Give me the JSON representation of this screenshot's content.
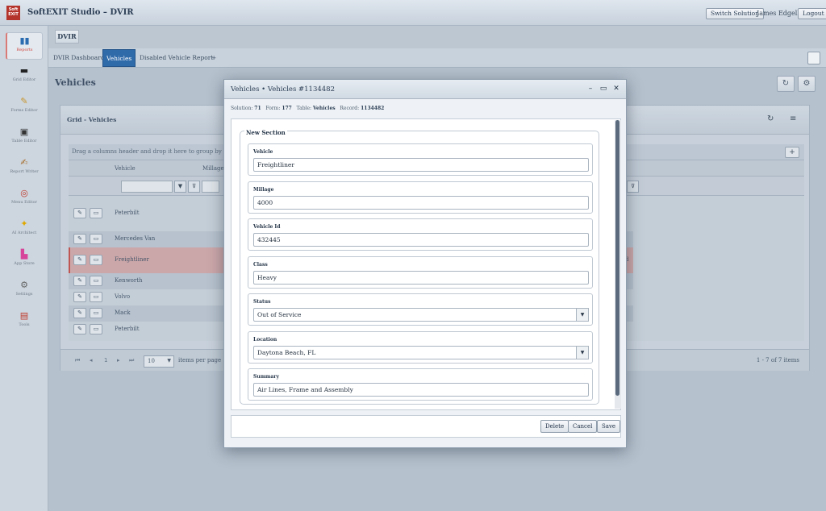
{
  "app": {
    "title": "SoftEXIT Studio – DVIR",
    "logo_text": "Soft EXIT"
  },
  "topbar": {
    "switch_solution": "Switch Solution",
    "user": "James Edgell",
    "logout": "Logout"
  },
  "sidebar": {
    "items": [
      {
        "label": "Reports",
        "icon": "bar-chart-icon",
        "glyph": "▮▮"
      },
      {
        "label": "Grid Editor",
        "icon": "monitor-icon",
        "glyph": "▬"
      },
      {
        "label": "Forms Editor",
        "icon": "pencil-icon",
        "glyph": "✎"
      },
      {
        "label": "Table Editor",
        "icon": "save-icon",
        "glyph": "▣"
      },
      {
        "label": "Report Writer",
        "icon": "writer-icon",
        "glyph": "✍"
      },
      {
        "label": "Menu Editor",
        "icon": "compass-icon",
        "glyph": "◎"
      },
      {
        "label": "AI Architect",
        "icon": "sparkle-icon",
        "glyph": "✦"
      },
      {
        "label": "App Store",
        "icon": "shopping-bag-icon",
        "glyph": "▙"
      },
      {
        "label": "Settings",
        "icon": "gear-icon",
        "glyph": "⚙"
      },
      {
        "label": "Tools",
        "icon": "toolbox-icon",
        "glyph": "▤"
      }
    ]
  },
  "breadcrumb": "DVIR",
  "tabs": [
    {
      "label": "DVIR Dashboard"
    },
    {
      "label": "Vehicles",
      "active": true
    },
    {
      "label": "Disabled Vehicle Report"
    },
    {
      "label": "+"
    }
  ],
  "page": {
    "title": "Vehicles"
  },
  "grid": {
    "title": "Grid - Vehicles",
    "group_hint": "Drag a columns header and drop it here to group by that colum",
    "columns": [
      "Vehicle",
      "Millage"
    ],
    "rows": [
      {
        "vehicle": "Peterbilt",
        "extra": ""
      },
      {
        "vehicle": "Mercedes Van",
        "extra": ""
      },
      {
        "vehicle": "Freightliner",
        "extra": "d"
      },
      {
        "vehicle": "Kenworth",
        "extra": ""
      },
      {
        "vehicle": "Volvo",
        "extra": ""
      },
      {
        "vehicle": "Mack",
        "extra": ""
      },
      {
        "vehicle": "Peterbilt",
        "extra": ""
      }
    ],
    "pager": {
      "page_size": "10",
      "items_per_page": "items per page",
      "summary": "1 - 7 of 7 items",
      "current_page": "1"
    }
  },
  "modal": {
    "title": "Vehicles • Vehicles #1134482",
    "meta": {
      "solution_label": "Solution:",
      "solution": "71",
      "form_label": "Form:",
      "form": "177",
      "table_label": "Table:",
      "table": "Vehicles",
      "record_label": "Record:",
      "record": "1134482"
    },
    "section_title": "New Section",
    "fields": [
      {
        "label": "Vehicle",
        "value": "Freightliner",
        "type": "text"
      },
      {
        "label": "Millage",
        "value": "4000",
        "type": "text"
      },
      {
        "label": "Vehicle Id",
        "value": "432445",
        "type": "text"
      },
      {
        "label": "Class",
        "value": "Heavy",
        "type": "text"
      },
      {
        "label": "Status",
        "value": "Out of Service",
        "type": "select"
      },
      {
        "label": "Location",
        "value": "Daytona Beach, FL",
        "type": "select"
      },
      {
        "label": "Summary",
        "value": "Air Lines, Frame and Assembly",
        "type": "text"
      }
    ],
    "buttons": {
      "delete": "Delete",
      "cancel": "Cancel",
      "save": "Save"
    }
  }
}
